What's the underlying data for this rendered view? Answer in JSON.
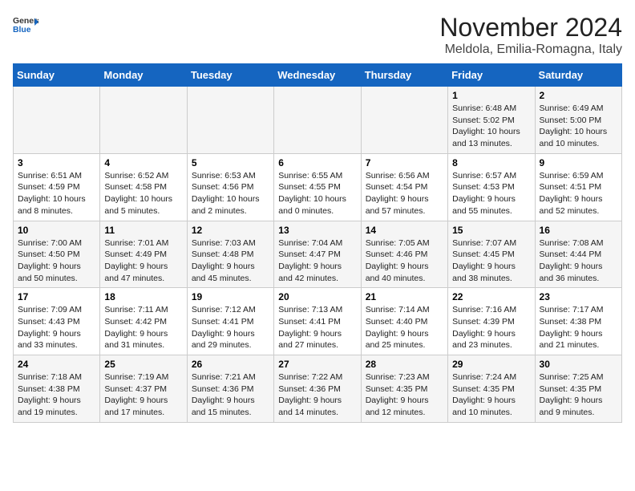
{
  "header": {
    "logo_general": "General",
    "logo_blue": "Blue",
    "month_title": "November 2024",
    "location": "Meldola, Emilia-Romagna, Italy"
  },
  "weekdays": [
    "Sunday",
    "Monday",
    "Tuesday",
    "Wednesday",
    "Thursday",
    "Friday",
    "Saturday"
  ],
  "weeks": [
    [
      {
        "day": "",
        "info": ""
      },
      {
        "day": "",
        "info": ""
      },
      {
        "day": "",
        "info": ""
      },
      {
        "day": "",
        "info": ""
      },
      {
        "day": "",
        "info": ""
      },
      {
        "day": "1",
        "info": "Sunrise: 6:48 AM\nSunset: 5:02 PM\nDaylight: 10 hours and 13 minutes."
      },
      {
        "day": "2",
        "info": "Sunrise: 6:49 AM\nSunset: 5:00 PM\nDaylight: 10 hours and 10 minutes."
      }
    ],
    [
      {
        "day": "3",
        "info": "Sunrise: 6:51 AM\nSunset: 4:59 PM\nDaylight: 10 hours and 8 minutes."
      },
      {
        "day": "4",
        "info": "Sunrise: 6:52 AM\nSunset: 4:58 PM\nDaylight: 10 hours and 5 minutes."
      },
      {
        "day": "5",
        "info": "Sunrise: 6:53 AM\nSunset: 4:56 PM\nDaylight: 10 hours and 2 minutes."
      },
      {
        "day": "6",
        "info": "Sunrise: 6:55 AM\nSunset: 4:55 PM\nDaylight: 10 hours and 0 minutes."
      },
      {
        "day": "7",
        "info": "Sunrise: 6:56 AM\nSunset: 4:54 PM\nDaylight: 9 hours and 57 minutes."
      },
      {
        "day": "8",
        "info": "Sunrise: 6:57 AM\nSunset: 4:53 PM\nDaylight: 9 hours and 55 minutes."
      },
      {
        "day": "9",
        "info": "Sunrise: 6:59 AM\nSunset: 4:51 PM\nDaylight: 9 hours and 52 minutes."
      }
    ],
    [
      {
        "day": "10",
        "info": "Sunrise: 7:00 AM\nSunset: 4:50 PM\nDaylight: 9 hours and 50 minutes."
      },
      {
        "day": "11",
        "info": "Sunrise: 7:01 AM\nSunset: 4:49 PM\nDaylight: 9 hours and 47 minutes."
      },
      {
        "day": "12",
        "info": "Sunrise: 7:03 AM\nSunset: 4:48 PM\nDaylight: 9 hours and 45 minutes."
      },
      {
        "day": "13",
        "info": "Sunrise: 7:04 AM\nSunset: 4:47 PM\nDaylight: 9 hours and 42 minutes."
      },
      {
        "day": "14",
        "info": "Sunrise: 7:05 AM\nSunset: 4:46 PM\nDaylight: 9 hours and 40 minutes."
      },
      {
        "day": "15",
        "info": "Sunrise: 7:07 AM\nSunset: 4:45 PM\nDaylight: 9 hours and 38 minutes."
      },
      {
        "day": "16",
        "info": "Sunrise: 7:08 AM\nSunset: 4:44 PM\nDaylight: 9 hours and 36 minutes."
      }
    ],
    [
      {
        "day": "17",
        "info": "Sunrise: 7:09 AM\nSunset: 4:43 PM\nDaylight: 9 hours and 33 minutes."
      },
      {
        "day": "18",
        "info": "Sunrise: 7:11 AM\nSunset: 4:42 PM\nDaylight: 9 hours and 31 minutes."
      },
      {
        "day": "19",
        "info": "Sunrise: 7:12 AM\nSunset: 4:41 PM\nDaylight: 9 hours and 29 minutes."
      },
      {
        "day": "20",
        "info": "Sunrise: 7:13 AM\nSunset: 4:41 PM\nDaylight: 9 hours and 27 minutes."
      },
      {
        "day": "21",
        "info": "Sunrise: 7:14 AM\nSunset: 4:40 PM\nDaylight: 9 hours and 25 minutes."
      },
      {
        "day": "22",
        "info": "Sunrise: 7:16 AM\nSunset: 4:39 PM\nDaylight: 9 hours and 23 minutes."
      },
      {
        "day": "23",
        "info": "Sunrise: 7:17 AM\nSunset: 4:38 PM\nDaylight: 9 hours and 21 minutes."
      }
    ],
    [
      {
        "day": "24",
        "info": "Sunrise: 7:18 AM\nSunset: 4:38 PM\nDaylight: 9 hours and 19 minutes."
      },
      {
        "day": "25",
        "info": "Sunrise: 7:19 AM\nSunset: 4:37 PM\nDaylight: 9 hours and 17 minutes."
      },
      {
        "day": "26",
        "info": "Sunrise: 7:21 AM\nSunset: 4:36 PM\nDaylight: 9 hours and 15 minutes."
      },
      {
        "day": "27",
        "info": "Sunrise: 7:22 AM\nSunset: 4:36 PM\nDaylight: 9 hours and 14 minutes."
      },
      {
        "day": "28",
        "info": "Sunrise: 7:23 AM\nSunset: 4:35 PM\nDaylight: 9 hours and 12 minutes."
      },
      {
        "day": "29",
        "info": "Sunrise: 7:24 AM\nSunset: 4:35 PM\nDaylight: 9 hours and 10 minutes."
      },
      {
        "day": "30",
        "info": "Sunrise: 7:25 AM\nSunset: 4:35 PM\nDaylight: 9 hours and 9 minutes."
      }
    ]
  ]
}
